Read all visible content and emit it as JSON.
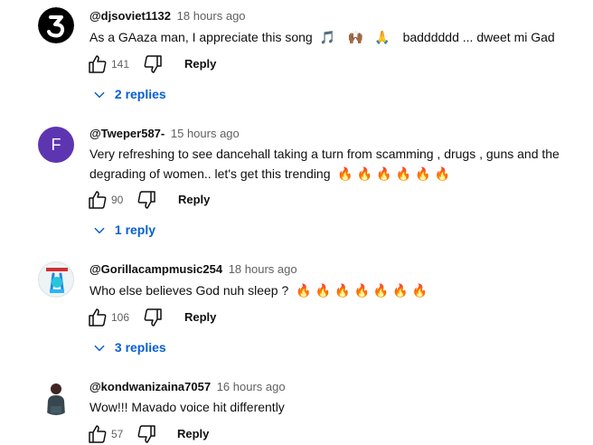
{
  "comments": [
    {
      "handle": "@djsoviet1132",
      "time": "18 hours ago",
      "text": "As a GAaza man, I appreciate this song",
      "text_after": "badddddd ... dweet mi Gad",
      "likes": "141",
      "reply_label": "Reply",
      "replies": "2 replies"
    },
    {
      "handle": "@Tweper587-",
      "time": "15 hours ago",
      "text": "Very refreshing to see dancehall taking a turn  from scamming , drugs , guns and the degrading of women.. let's get this trending",
      "avatar_letter": "F",
      "likes": "90",
      "reply_label": "Reply",
      "replies": "1 reply"
    },
    {
      "handle": "@Gorillacampmusic254",
      "time": "18 hours ago",
      "text": "Who else believes God nuh sleep ?",
      "likes": "106",
      "reply_label": "Reply",
      "replies": "3 replies"
    },
    {
      "handle": "@kondwanizaina7057",
      "time": "16 hours ago",
      "text": "Wow!!! Mavado voice hit differently",
      "likes": "57",
      "reply_label": "Reply"
    }
  ],
  "colors": {
    "accent": "#065fd4",
    "avatar_f": "#5e35b1"
  },
  "icons": [
    "like-icon",
    "dislike-icon",
    "chevron-down-icon",
    "fire-emoji",
    "music-note-emoji",
    "praising-hands-emoji",
    "folded-hands-emoji"
  ]
}
